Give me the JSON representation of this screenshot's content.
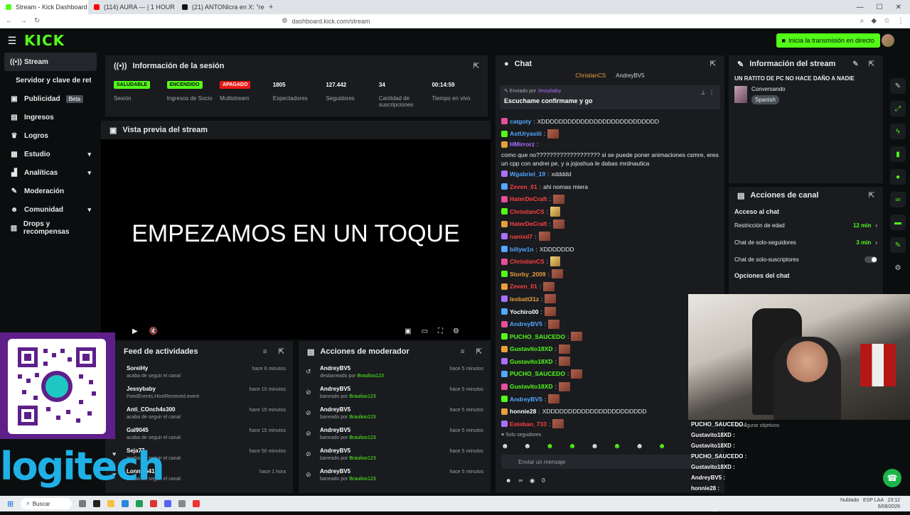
{
  "browser": {
    "tabs": [
      {
        "title": "Stream - Kick Dashboard",
        "active": true,
        "color": "#53fc18"
      },
      {
        "title": "(114) AURA — | 1 HOUR VIRA",
        "active": false,
        "color": "#ff0000"
      },
      {
        "title": "(21) ANTONIcra en X: \"recuperando",
        "active": false,
        "color": "#111111"
      }
    ],
    "url": "dashboard.kick.com/stream"
  },
  "header": {
    "logo": "KICK",
    "live_button": "Inicia la transmisión en directo"
  },
  "sidebar": {
    "items": [
      {
        "label": "Stream",
        "icon": "broadcast-icon",
        "active": true
      },
      {
        "label": "Servidor y clave de retransmisión",
        "icon": "",
        "sub": true
      },
      {
        "label": "Publicidad",
        "icon": "ad-icon",
        "badge": "Beta"
      },
      {
        "label": "Ingresos",
        "icon": "money-icon"
      },
      {
        "label": "Logros",
        "icon": "trophy-icon"
      },
      {
        "label": "Estudio",
        "icon": "studio-icon",
        "chevron": true
      },
      {
        "label": "Analíticas",
        "icon": "chart-icon",
        "chevron": true
      },
      {
        "label": "Moderación",
        "icon": "wrench-icon"
      },
      {
        "label": "Comunidad",
        "icon": "people-icon",
        "chevron": true
      },
      {
        "label": "Drops y recompensas",
        "icon": "gift-icon"
      }
    ]
  },
  "session": {
    "title": "Información de la sesión",
    "stats": [
      {
        "value": "SALUDABLE",
        "label": "Sesión",
        "pill": "green"
      },
      {
        "value": "ENCENDIDO",
        "label": "Ingresos de Socio",
        "pill": "green"
      },
      {
        "value": "APAGADO",
        "label": "Multistream",
        "pill": "red"
      },
      {
        "value": "1805",
        "label": "Espectadores"
      },
      {
        "value": "127.442",
        "label": "Seguidores"
      },
      {
        "value": "34",
        "label": "Cantidad de suscripciones"
      },
      {
        "value": "00:14:59",
        "label": "Tiempo en vivo"
      }
    ]
  },
  "preview": {
    "title": "Vista previa del stream",
    "text": "EMPEZAMOS EN UN TOQUE"
  },
  "activity": {
    "title": "Feed de actividades",
    "rows": [
      {
        "name": "SoreiHy",
        "sub": "acaba de seguir el canal",
        "time": "hace 6 minutos"
      },
      {
        "name": "Jessybaby",
        "sub": "FeedEvents.HostReceived.event",
        "time": "hace 10 minutos"
      },
      {
        "name": "Anti_COnch4s300",
        "sub": "acaba de seguir el canal",
        "time": "hace 15 minutos"
      },
      {
        "name": "Gal9045",
        "sub": "acaba de seguir el canal",
        "time": "hace 15 minutos"
      },
      {
        "name": "Seja77",
        "sub": "acaba de seguir el canal",
        "time": "hace 50 minutos"
      },
      {
        "name": "Lonnie5412",
        "sub": "acaba de seguir el canal",
        "time": "hace 1 hora"
      }
    ]
  },
  "modactions": {
    "title": "Acciones de moderador",
    "rows": [
      {
        "name": "AndreyBV5",
        "sub": "desbaneado por ",
        "by": "Braulioo123",
        "time": "hace 5 minutos",
        "icon": "undo-icon"
      },
      {
        "name": "AndreyBV5",
        "sub": "baneado por ",
        "by": "Braulioo123",
        "time": "hace 5 minutos",
        "icon": "ban-icon"
      },
      {
        "name": "AndreyBV5",
        "sub": "baneado por ",
        "by": "Braulioo123",
        "time": "hace 5 minutos",
        "icon": "ban-icon"
      },
      {
        "name": "AndreyBV5",
        "sub": "baneado por ",
        "by": "Braulioo123",
        "time": "hace 5 minutos",
        "icon": "ban-icon"
      },
      {
        "name": "AndreyBV5",
        "sub": "baneado por ",
        "by": "Braulioo123",
        "time": "hace 5 minutos",
        "icon": "ban-icon"
      },
      {
        "name": "AndreyBV5",
        "sub": "baneado por ",
        "by": "Braulioo123",
        "time": "hace 5 minutos",
        "icon": "ban-icon"
      }
    ]
  },
  "chat": {
    "title": "Chat",
    "top": [
      "ChristianCS",
      "AndreyBV5"
    ],
    "pinned_from": "Enviado por ",
    "pinned_user": "Jessybaby",
    "pinned_msg": "Escuchame confirmame y go",
    "lines": [
      {
        "user": "catgoty",
        "color": "#53a8ff",
        "msg": "XDDDDDDDDDDDDDDDDDDDDDDDDDDD"
      },
      {
        "user": "AstUryasiti",
        "color": "#53a8ff",
        "emote": true
      },
      {
        "user": "HMirrorz",
        "color": "#a970ff",
        "msg": "como que no??????????????????? si se puede poner animaciones csmre, eres un cpp con andrei pe, y a jojoshua le dabas mrdnautica"
      },
      {
        "user": "Wgabriel_19",
        "color": "#53a8ff",
        "msg": "xddddd"
      },
      {
        "user": "Zeven_01",
        "color": "#ff4040",
        "msg": "ahi nomas miera"
      },
      {
        "user": "HaterDeCraft",
        "color": "#ff4040",
        "emote": true
      },
      {
        "user": "ChristianCS",
        "color": "#ff4040",
        "emote2": true
      },
      {
        "user": "HaterDeCraft",
        "color": "#ff4040",
        "emote": true
      },
      {
        "user": "nanixd7",
        "color": "#ff4040",
        "emote": true
      },
      {
        "user": "billyw1n",
        "color": "#53a8ff",
        "msg": "XDDDDDDD"
      },
      {
        "user": "ChristianCS",
        "color": "#ff4040",
        "emote2": true
      },
      {
        "user": "Storby_2009",
        "color": "#e8a03a",
        "emote": true
      },
      {
        "user": "Zeven_01",
        "color": "#ff4040",
        "emote": true
      },
      {
        "user": "lexbatt31z",
        "color": "#e8a03a",
        "emote": true
      },
      {
        "user": "Yochiro00",
        "color": "#ffffff",
        "emote": true
      },
      {
        "user": "AndreyBV5",
        "color": "#53a8ff",
        "emote": true
      },
      {
        "user": "PUCHO_SAUCEDO",
        "color": "#53fc18",
        "emote": true
      },
      {
        "user": "Gustavito18XD",
        "color": "#53fc18",
        "emote": true
      },
      {
        "user": "Gustavito18XD",
        "color": "#53fc18",
        "emote": true
      },
      {
        "user": "PUCHO_SAUCEDO",
        "color": "#53fc18",
        "emote": true
      },
      {
        "user": "Gustavito18XD",
        "color": "#53fc18",
        "emote": true
      },
      {
        "user": "AndreyBV5",
        "color": "#53a8ff",
        "emote": true
      },
      {
        "user": "honnie28",
        "color": "#ffffff",
        "msg": "XDDDDDDDDDDDDDDDDDDDDDDD"
      },
      {
        "user": "Esteban_733",
        "color": "#ff4040",
        "emote": true
      }
    ],
    "follow_only": "Solo seguidores",
    "input_placeholder": "Enviar un mensaje",
    "count": "0"
  },
  "stream_info": {
    "title": "Información del stream",
    "stream_title": "UN RATITO DE PC NO HACE DAÑO A NADIE",
    "category": "Conversando",
    "language": "Spanish"
  },
  "channel_actions": {
    "title": "Acciones de canal",
    "section": "Acceso al chat",
    "settings": [
      {
        "label": "Restricción de edad",
        "value": "12 min"
      },
      {
        "label": "Chat de solo-seguidores",
        "value": "3 min"
      },
      {
        "label": "Chat de solo-suscriptores",
        "value": ""
      }
    ],
    "options": "Opciones del chat"
  },
  "overlay": {
    "configure": "Configurar objetivos",
    "lines": [
      "PUCHO_SAUCEDO :",
      "Gustavito18XD :",
      "Gustavito18XD :",
      "PUCHO_SAUCEDO :",
      "Gustavito18XD :",
      "AndreyBV5 :",
      "honnie28 : XDDDDDDDDDDDDDDDDDDDDDD",
      "Esteban_733 :"
    ],
    "logitech": "logitech"
  },
  "taskbar": {
    "search": "Buscar",
    "weather": "Nublado",
    "lang": "ESP LAA",
    "time": "23:12",
    "date": "6/08/2026"
  }
}
